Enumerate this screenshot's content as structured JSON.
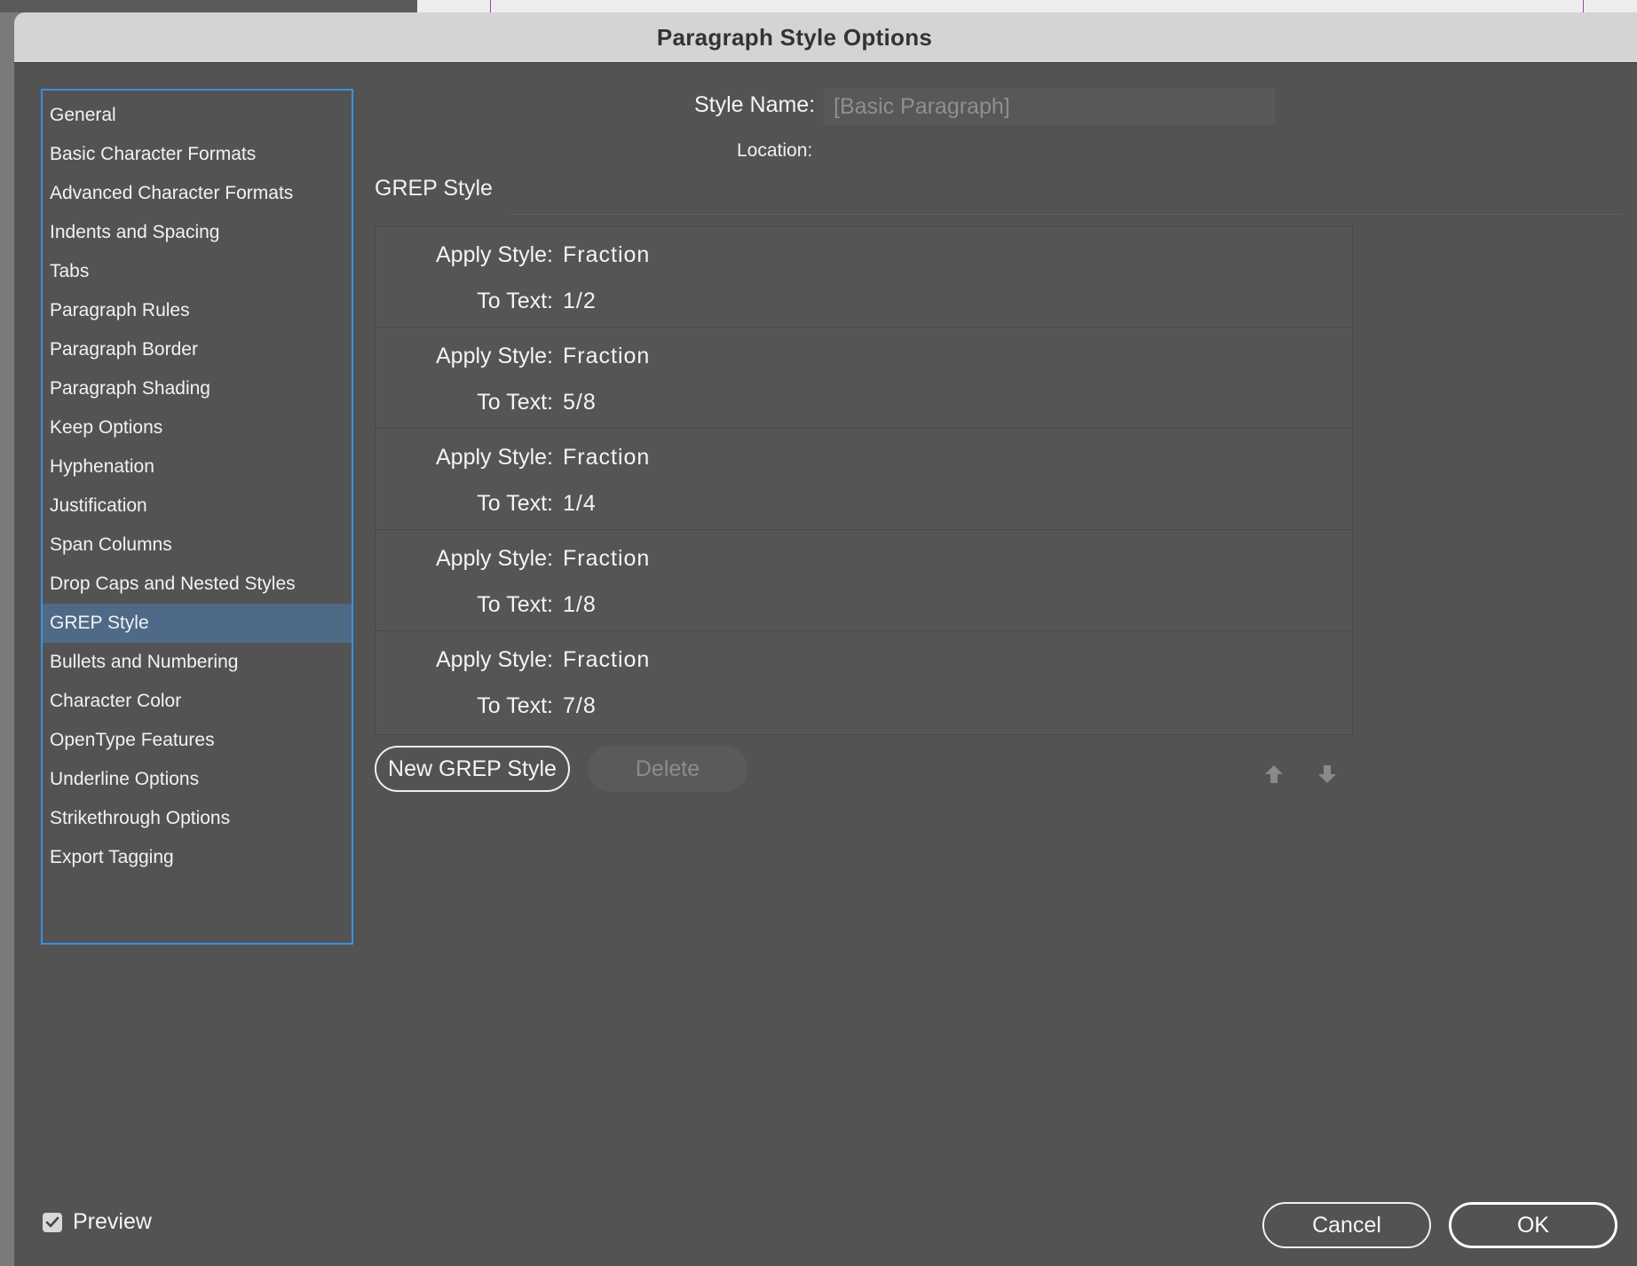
{
  "window": {
    "title": "Paragraph Style Options"
  },
  "sidebar": {
    "items": [
      {
        "label": "General"
      },
      {
        "label": "Basic Character Formats"
      },
      {
        "label": "Advanced Character Formats"
      },
      {
        "label": "Indents and Spacing"
      },
      {
        "label": "Tabs"
      },
      {
        "label": "Paragraph Rules"
      },
      {
        "label": "Paragraph Border"
      },
      {
        "label": "Paragraph Shading"
      },
      {
        "label": "Keep Options"
      },
      {
        "label": "Hyphenation"
      },
      {
        "label": "Justification"
      },
      {
        "label": "Span Columns"
      },
      {
        "label": "Drop Caps and Nested Styles"
      },
      {
        "label": "GREP Style",
        "selected": true
      },
      {
        "label": "Bullets and Numbering"
      },
      {
        "label": "Character Color"
      },
      {
        "label": "OpenType Features"
      },
      {
        "label": "Underline Options"
      },
      {
        "label": "Strikethrough Options"
      },
      {
        "label": "Export Tagging"
      }
    ]
  },
  "form": {
    "style_name_label": "Style Name:",
    "style_name_value": "[Basic Paragraph]",
    "location_label": "Location:"
  },
  "section": {
    "title": "GREP Style"
  },
  "grep_rules": {
    "apply_label": "Apply Style:",
    "text_label": "To Text:",
    "rows": [
      {
        "style": "Fraction",
        "text": "1/2"
      },
      {
        "style": "Fraction",
        "text": "5/8"
      },
      {
        "style": "Fraction",
        "text": "1/4"
      },
      {
        "style": "Fraction",
        "text": "1/8"
      },
      {
        "style": "Fraction",
        "text": "7/8"
      }
    ]
  },
  "buttons": {
    "new_grep": "New GREP Style",
    "delete": "Delete",
    "cancel": "Cancel",
    "ok": "OK"
  },
  "preview": {
    "label": "Preview",
    "checked": true
  },
  "colors": {
    "dialog_bg": "#535353",
    "titlebar_bg": "#d4d4d4",
    "selection_bg": "#4f6a87",
    "focus_border": "#3d8fe0"
  }
}
